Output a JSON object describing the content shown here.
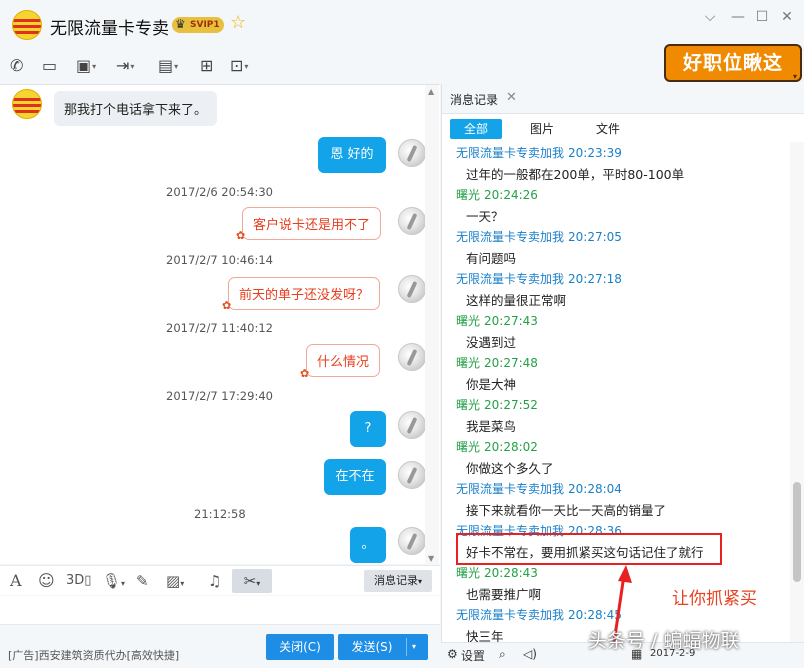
{
  "window": {
    "title": "无限流量卡专卖",
    "svip": "SVIP1"
  },
  "banner": {
    "text": "好职位瞅这"
  },
  "chat": {
    "first_message": "那我打个电话拿下来了。",
    "items": [
      {
        "type": "blue",
        "text": "恩 好的"
      },
      {
        "type": "time",
        "text": "2017/2/6 20:54:30"
      },
      {
        "type": "red",
        "text": "客户说卡还是用不了"
      },
      {
        "type": "time",
        "text": "2017/2/7 10:46:14"
      },
      {
        "type": "red",
        "text": "前天的单子还没发呀？"
      },
      {
        "type": "time",
        "text": "2017/2/7 11:40:12"
      },
      {
        "type": "red",
        "text": "什么情况"
      },
      {
        "type": "time",
        "text": "2017/2/7 17:29:40"
      },
      {
        "type": "blue",
        "text": "?"
      },
      {
        "type": "blue",
        "text": "在不在"
      },
      {
        "type": "time",
        "text": "21:12:58"
      },
      {
        "type": "blue",
        "text": "。"
      }
    ]
  },
  "input_toolbar": {
    "history_label": "消息记录",
    "font_label": "A",
    "gif_label": "3D"
  },
  "bottom": {
    "ad": "[广告]西安建筑资质代办[高效快捷]",
    "close_label": "关闭(C)",
    "send_label": "发送(S)"
  },
  "history": {
    "tab_title": "消息记录",
    "filters": [
      "全部",
      "图片",
      "文件"
    ],
    "messages": [
      {
        "sender": "无限流量卡专卖加我",
        "time": "20:23:39",
        "color": "b",
        "text": "过年的一般都在200单，平时80-100单"
      },
      {
        "sender": "曙光",
        "time": "20:24:26",
        "color": "g",
        "text": "一天？"
      },
      {
        "sender": "无限流量卡专卖加我",
        "time": "20:27:05",
        "color": "b",
        "text": "有问题吗"
      },
      {
        "sender": "无限流量卡专卖加我",
        "time": "20:27:18",
        "color": "b",
        "text": "这样的量很正常啊"
      },
      {
        "sender": "曙光",
        "time": "20:27:43",
        "color": "g",
        "text": "没遇到过"
      },
      {
        "sender": "曙光",
        "time": "20:27:48",
        "color": "g",
        "text": "你是大神"
      },
      {
        "sender": "曙光",
        "time": "20:27:52",
        "color": "g",
        "text": "我是菜鸟"
      },
      {
        "sender": "曙光",
        "time": "20:28:02",
        "color": "g",
        "text": "你做这个多久了"
      },
      {
        "sender": "无限流量卡专卖加我",
        "time": "20:28:04",
        "color": "b",
        "text": "接下来就看你一天比一天高的销量了"
      },
      {
        "sender": "无限流量卡专卖加我",
        "time": "20:28:36",
        "color": "b",
        "text": "好卡不常在，要用抓紧买这句话记住了就行"
      },
      {
        "sender": "曙光",
        "time": "20:28:43",
        "color": "g",
        "text": "也需要推广啊"
      },
      {
        "sender": "无限流量卡专卖加我",
        "time": "20:28:45",
        "color": "b",
        "text": "快三年"
      }
    ],
    "settings_label": "设置",
    "date_label": "2017-2-9"
  },
  "annotation": {
    "text": "让你抓紧买"
  },
  "watermark": {
    "text": "头条号 / 蝙蝠物联"
  },
  "colors": {
    "accent": "#12a3e8",
    "highlight": "#e82020",
    "sender_blue": "#1a7fc9",
    "sender_green": "#24a046"
  }
}
